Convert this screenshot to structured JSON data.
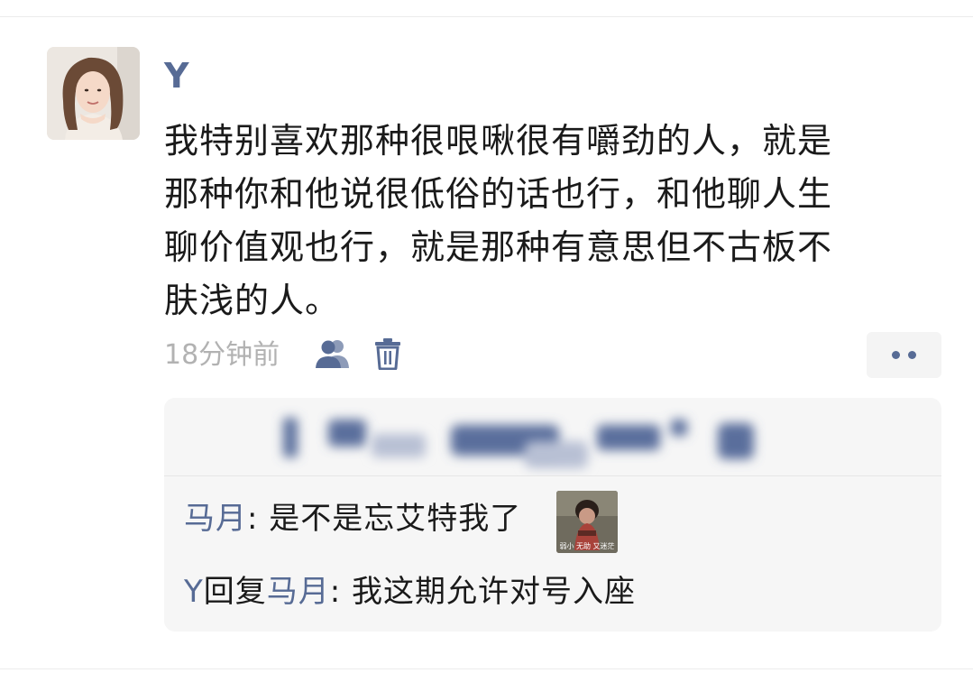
{
  "post": {
    "username": "Y",
    "text_lines": [
      "我特别喜欢那种很哏啾很有嚼劲的人，就是",
      "那种你和他说很低俗的话也行，和他聊人生",
      "聊价值观也行，就是那种有意思但不古板不",
      "肤浅的人。"
    ],
    "timestamp": "18分钟前",
    "icons": {
      "visibility": "people-icon",
      "delete": "trash-icon",
      "more": "more-dots-icon"
    }
  },
  "comments": [
    {
      "author": "马月",
      "separator": ": ",
      "text": "是不是忘艾特我了",
      "sticker_caption": "弱小 无助 又迷茫"
    },
    {
      "author": "Y",
      "reply_word": "回复",
      "reply_to": "马月",
      "separator": ": ",
      "text": "我这期允许对号入座"
    }
  ],
  "colors": {
    "name_link": "#576b95",
    "body_text": "#1a1a1a",
    "timestamp": "#b2b2b2",
    "comment_bg": "#f6f6f6"
  }
}
